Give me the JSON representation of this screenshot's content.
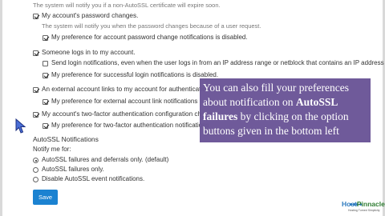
{
  "notifications": {
    "intro_help": "The system will notify you if a non-AutoSSL certificate will expire soon.",
    "items": [
      {
        "label": "My account's password changes.",
        "help": "The system will notify you when the password changes because of a user request.",
        "preference": "My preference for account password change notifications is disabled."
      },
      {
        "label": "Someone logs in to my account.",
        "sub1": "Send login notifications, even when the user logs in from an IP address range or netblock that contains an IP address",
        "preference": "My preference for successful login notifications is disabled."
      },
      {
        "label": "An external account links to my account for authentication",
        "preference": "My preference for external account link notifications"
      },
      {
        "label": "My account's two-factor authentication configuration ch",
        "preference": "My preference for two-factor authentication notifications"
      }
    ]
  },
  "autossl": {
    "title": "AutoSSL Notifications",
    "notify_label": "Notify me for:",
    "options": [
      "AutoSSL failures and deferrals only. (default)",
      "AutoSSL failures only.",
      "Disable AutoSSL event notifications."
    ],
    "selected_index": 0
  },
  "save_label": "Save",
  "overlay": {
    "part1": "You can also fill your preferences about notification on ",
    "bold": "AutoSSL failures",
    "part2": " by clicking on the option buttons given in the bottom left corner."
  },
  "logo": {
    "brand_h": "Host",
    "brand_p": "Pinnacle",
    "tagline": "Hosting Turned Simplicity"
  },
  "icons": {
    "cursor": "mouse-pointer-icon"
  }
}
